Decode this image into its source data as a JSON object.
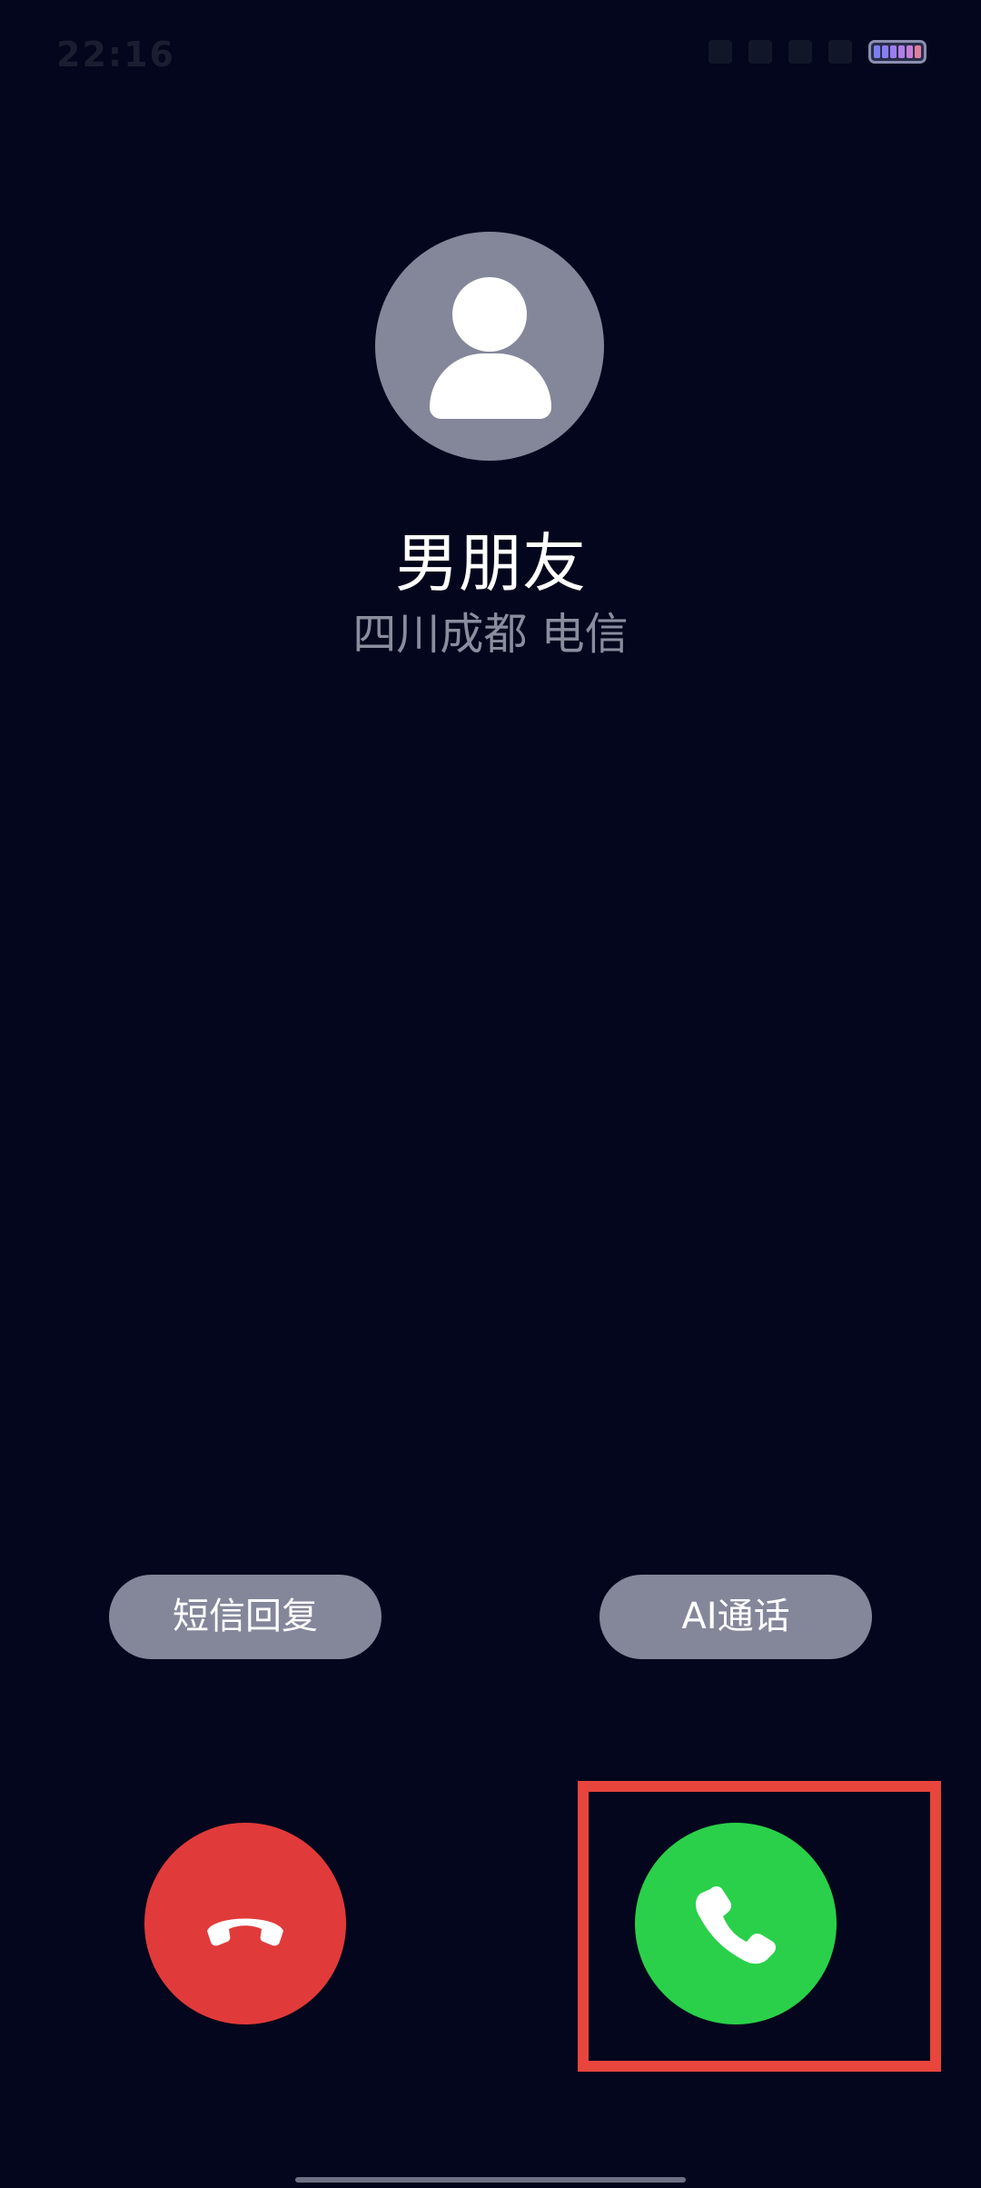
{
  "status_bar": {
    "time": "22:16",
    "battery_colors": [
      "#7d7df0",
      "#8a7ef0",
      "#9a7ef0",
      "#b07ee8",
      "#c87ed8",
      "#e07ea0"
    ]
  },
  "caller": {
    "name": "男朋友",
    "location": "四川成都 电信"
  },
  "actions": {
    "sms_reply_label": "短信回复",
    "ai_call_label": "AI通话"
  },
  "colors": {
    "background": "#03061c",
    "decline": "#e13a3a",
    "answer": "#2ad04a",
    "highlight": "#e8453c"
  },
  "icons": {
    "avatar": "person-icon",
    "decline": "hang-up-phone-icon",
    "answer": "phone-icon"
  }
}
